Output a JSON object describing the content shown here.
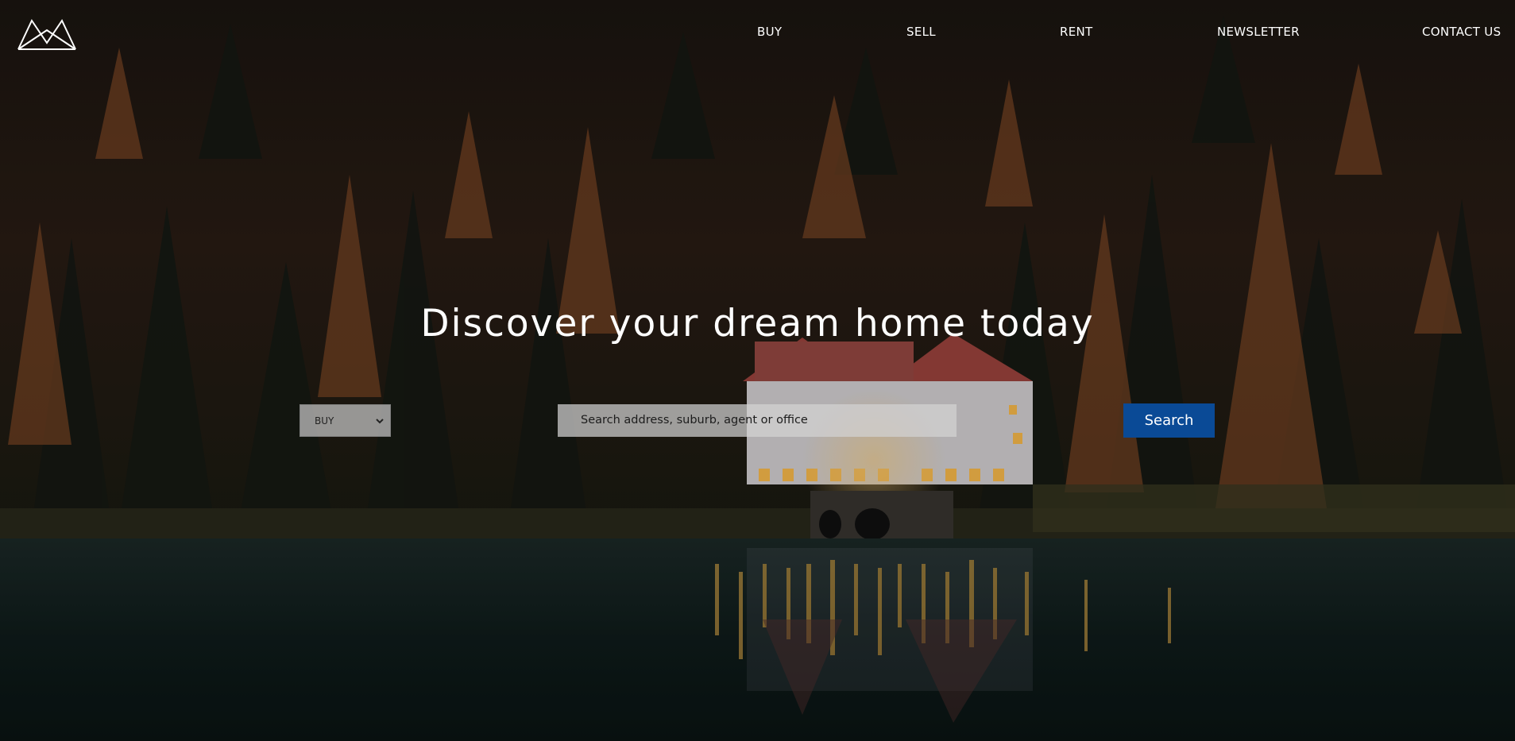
{
  "header": {
    "logo_icon": "mountain-m-logo-icon",
    "nav": [
      {
        "label": "BUY"
      },
      {
        "label": "SELL"
      },
      {
        "label": "RENT"
      },
      {
        "label": "NEWSLETTER"
      },
      {
        "label": "CONTACT US"
      }
    ]
  },
  "hero": {
    "headline": "Discover your dream home today",
    "type_select": {
      "selected": "BUY",
      "icon": "chevron-down-icon"
    },
    "search": {
      "placeholder": "Search address, suburb, agent or office"
    },
    "search_button": "Search"
  },
  "colors": {
    "accent": "#0a4a96",
    "text": "#ffffff"
  }
}
